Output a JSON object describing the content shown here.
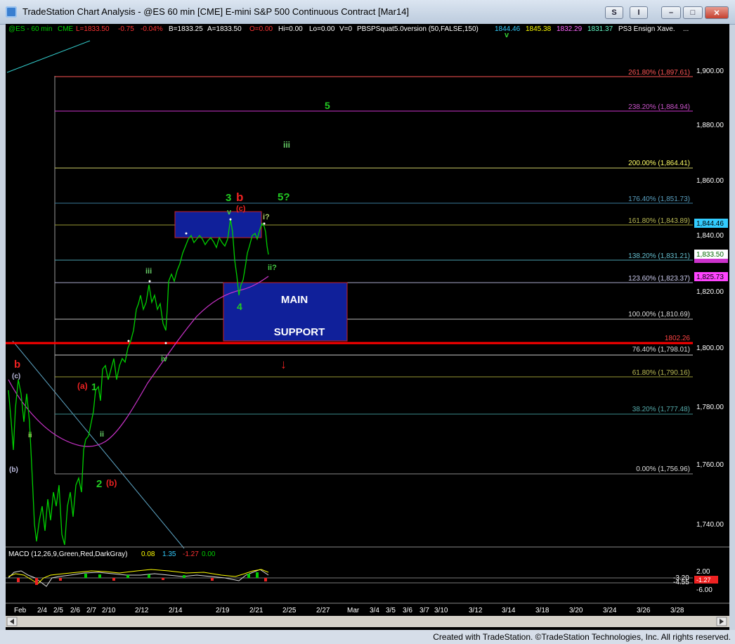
{
  "window": {
    "title": "TradeStation Chart Analysis - @ES 60 min [CME] E-mini S&P 500 Continuous Contract [Mar14]",
    "btn_s": "S",
    "btn_i": "I",
    "btn_min": "–",
    "btn_max": "□",
    "btn_close": "✕"
  },
  "colors": {
    "background": "#000000",
    "price_line": "#00d000",
    "ma_line": "#cc33cc",
    "support_box": "#0d1f8c",
    "support_line": "#ff0000"
  },
  "header": {
    "symbol": "@ES - 60 min",
    "exchange": "CME",
    "last": "L=1833.50",
    "change": "-0.75",
    "pct": "-0.04%",
    "bid": "B=1833.25",
    "ask": "A=1833.50",
    "open": "O=0.00",
    "hi": "Hi=0.00",
    "lo": "Lo=0.00",
    "vol": "V=0",
    "indicator": "PBSPSquat5.0version (50,FALSE,150)",
    "v1": "1844.46",
    "v2": "1845.38",
    "v3": "1832.29",
    "v4": "1831.37",
    "study": "PS3 Ensign Xave.",
    "dots": "..."
  },
  "price_axis": {
    "ticks": [
      "1,900.00",
      "1,880.00",
      "1,860.00",
      "1,840.00",
      "1,820.00",
      "1,800.00",
      "1,780.00",
      "1,760.00",
      "1,740.00"
    ],
    "boxes": {
      "current": "1,844.46",
      "last": "1,833.50",
      "ma": "1,825.73"
    }
  },
  "fib_levels": [
    {
      "label": "261.80% (1,897.61)"
    },
    {
      "label": "238.20% (1,884.94)"
    },
    {
      "label": "200.00% (1,864.41)"
    },
    {
      "label": "176.40% (1,851.73)"
    },
    {
      "label": "161.80% (1,843.89)"
    },
    {
      "label": "138.20% (1,831.21)"
    },
    {
      "label": "123.60% (1,823.37)"
    },
    {
      "label": "100.00% (1,810.69)"
    },
    {
      "label": "76.40% (1,798.01)"
    },
    {
      "label": "61.80% (1,790.16)"
    },
    {
      "label": "38.20% (1,777.48)"
    },
    {
      "label": "0.00% (1,756.96)"
    }
  ],
  "support": {
    "label": "1802.26",
    "box_line1": "MAIN",
    "box_line2": "SUPPORT"
  },
  "wave_labels": {
    "five_top": "5",
    "iii_top": "iii",
    "three": "3",
    "b_big": "b",
    "c_paren": "(c)",
    "v_small": "v",
    "five_q": "5?",
    "i_q": "i?",
    "ii_q": "ii?",
    "four": "4",
    "iii_mid": "iii",
    "iv": "iv",
    "b_left": "b",
    "c_left": "(c)",
    "ii_left": "ii",
    "b_paren_left": "(b)",
    "a_paren": "(a)",
    "one": "1",
    "ii_mid": "ii",
    "two": "2",
    "b_paren": "(b)",
    "v_top": "v",
    "arrow": "↓"
  },
  "macd": {
    "label": "MACD (12,26,9,Green,Red,DarkGray)",
    "v1": "0.08",
    "v2": "1.35",
    "v3": "-1.27",
    "v4": "0.00",
    "ticks": [
      "2.00",
      "-6.00"
    ],
    "box1": "-1.27",
    "tick_mid1": "-3.20",
    "tick_mid2": "-4.55"
  },
  "date_axis": [
    "Feb",
    "2/4",
    "2/5",
    "2/6",
    "2/7",
    "2/10",
    "2/12",
    "2/14",
    "2/19",
    "2/21",
    "2/25",
    "2/27",
    "Mar",
    "3/4",
    "3/5",
    "3/6",
    "3/7",
    "3/10",
    "3/12",
    "3/14",
    "3/18",
    "3/20",
    "3/24",
    "3/26",
    "3/28"
  ],
  "status": "Created with TradeStation. ©TradeStation Technologies, Inc. All rights reserved."
}
